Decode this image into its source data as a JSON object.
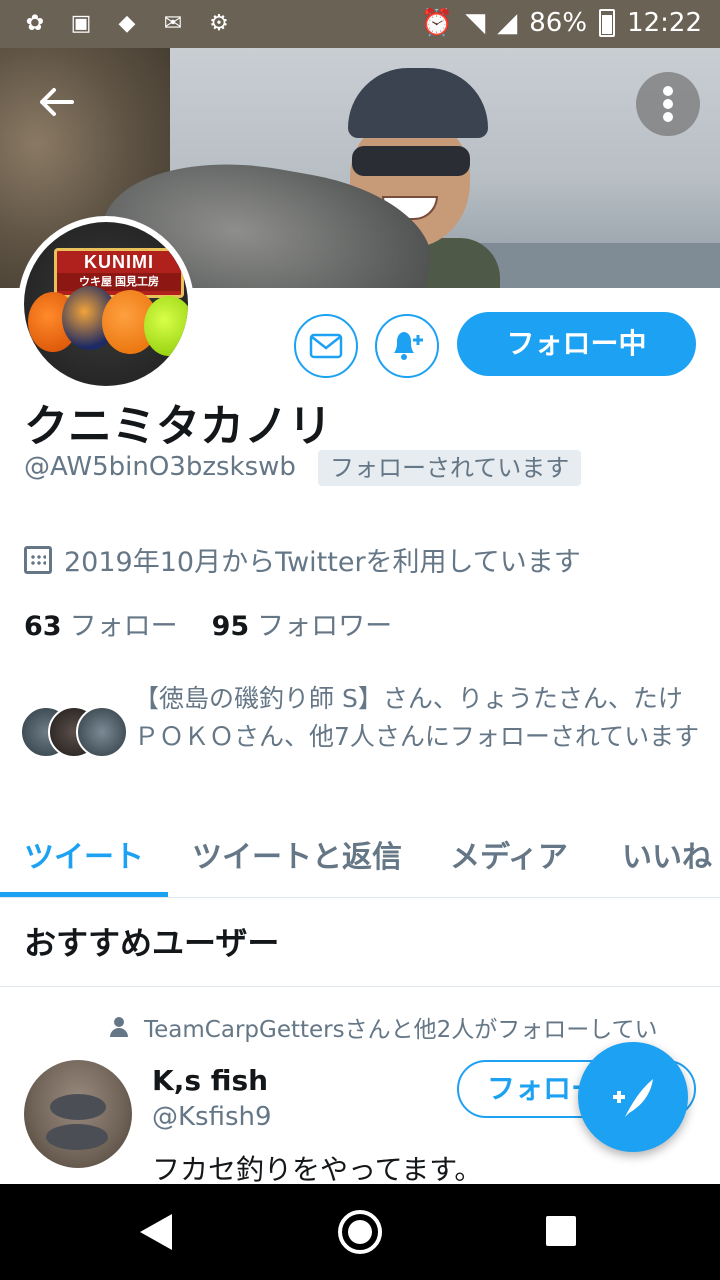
{
  "status_bar": {
    "battery": "86%",
    "time": "12:22"
  },
  "profile": {
    "name": "クニミタカノリ",
    "handle": "@AW5binO3bzskswb",
    "follows_you_badge": "フォローされています",
    "joined": "2019年10月からTwitterを利用しています",
    "following_count": "63",
    "following_label": "フォロー",
    "followers_count": "95",
    "followers_label": "フォロワー",
    "follow_button": "フォロー中",
    "mutual_followers": "【徳島の磯釣り師 S】さん、りょうたさん、たけＰＯＫＯさん、他7人さんにフォローされています"
  },
  "avatar_logo": {
    "top": "KUNIMI",
    "bottom": "ウキ屋 国見工房"
  },
  "tabs": [
    {
      "label": "ツイート",
      "active": true
    },
    {
      "label": "ツイートと返信",
      "active": false
    },
    {
      "label": "メディア",
      "active": false
    },
    {
      "label": "いいね",
      "active": false
    }
  ],
  "recommended": {
    "title": "おすすめユーザー",
    "social_context": "TeamCarpGettersさんと他2人がフォローしてい",
    "user_name": "K,s fish",
    "user_handle": "@Ksfish9",
    "user_bio": "フカセ釣りをやってます。",
    "follow_label": "フォロー"
  },
  "colors": {
    "accent": "#1da1f2",
    "secondary_text": "#657786"
  },
  "icons": {
    "back": "arrow-left-icon",
    "more": "more-vertical-icon",
    "message": "mail-icon",
    "notify": "bell-plus-icon",
    "calendar": "calendar-icon",
    "compose": "compose-icon"
  }
}
